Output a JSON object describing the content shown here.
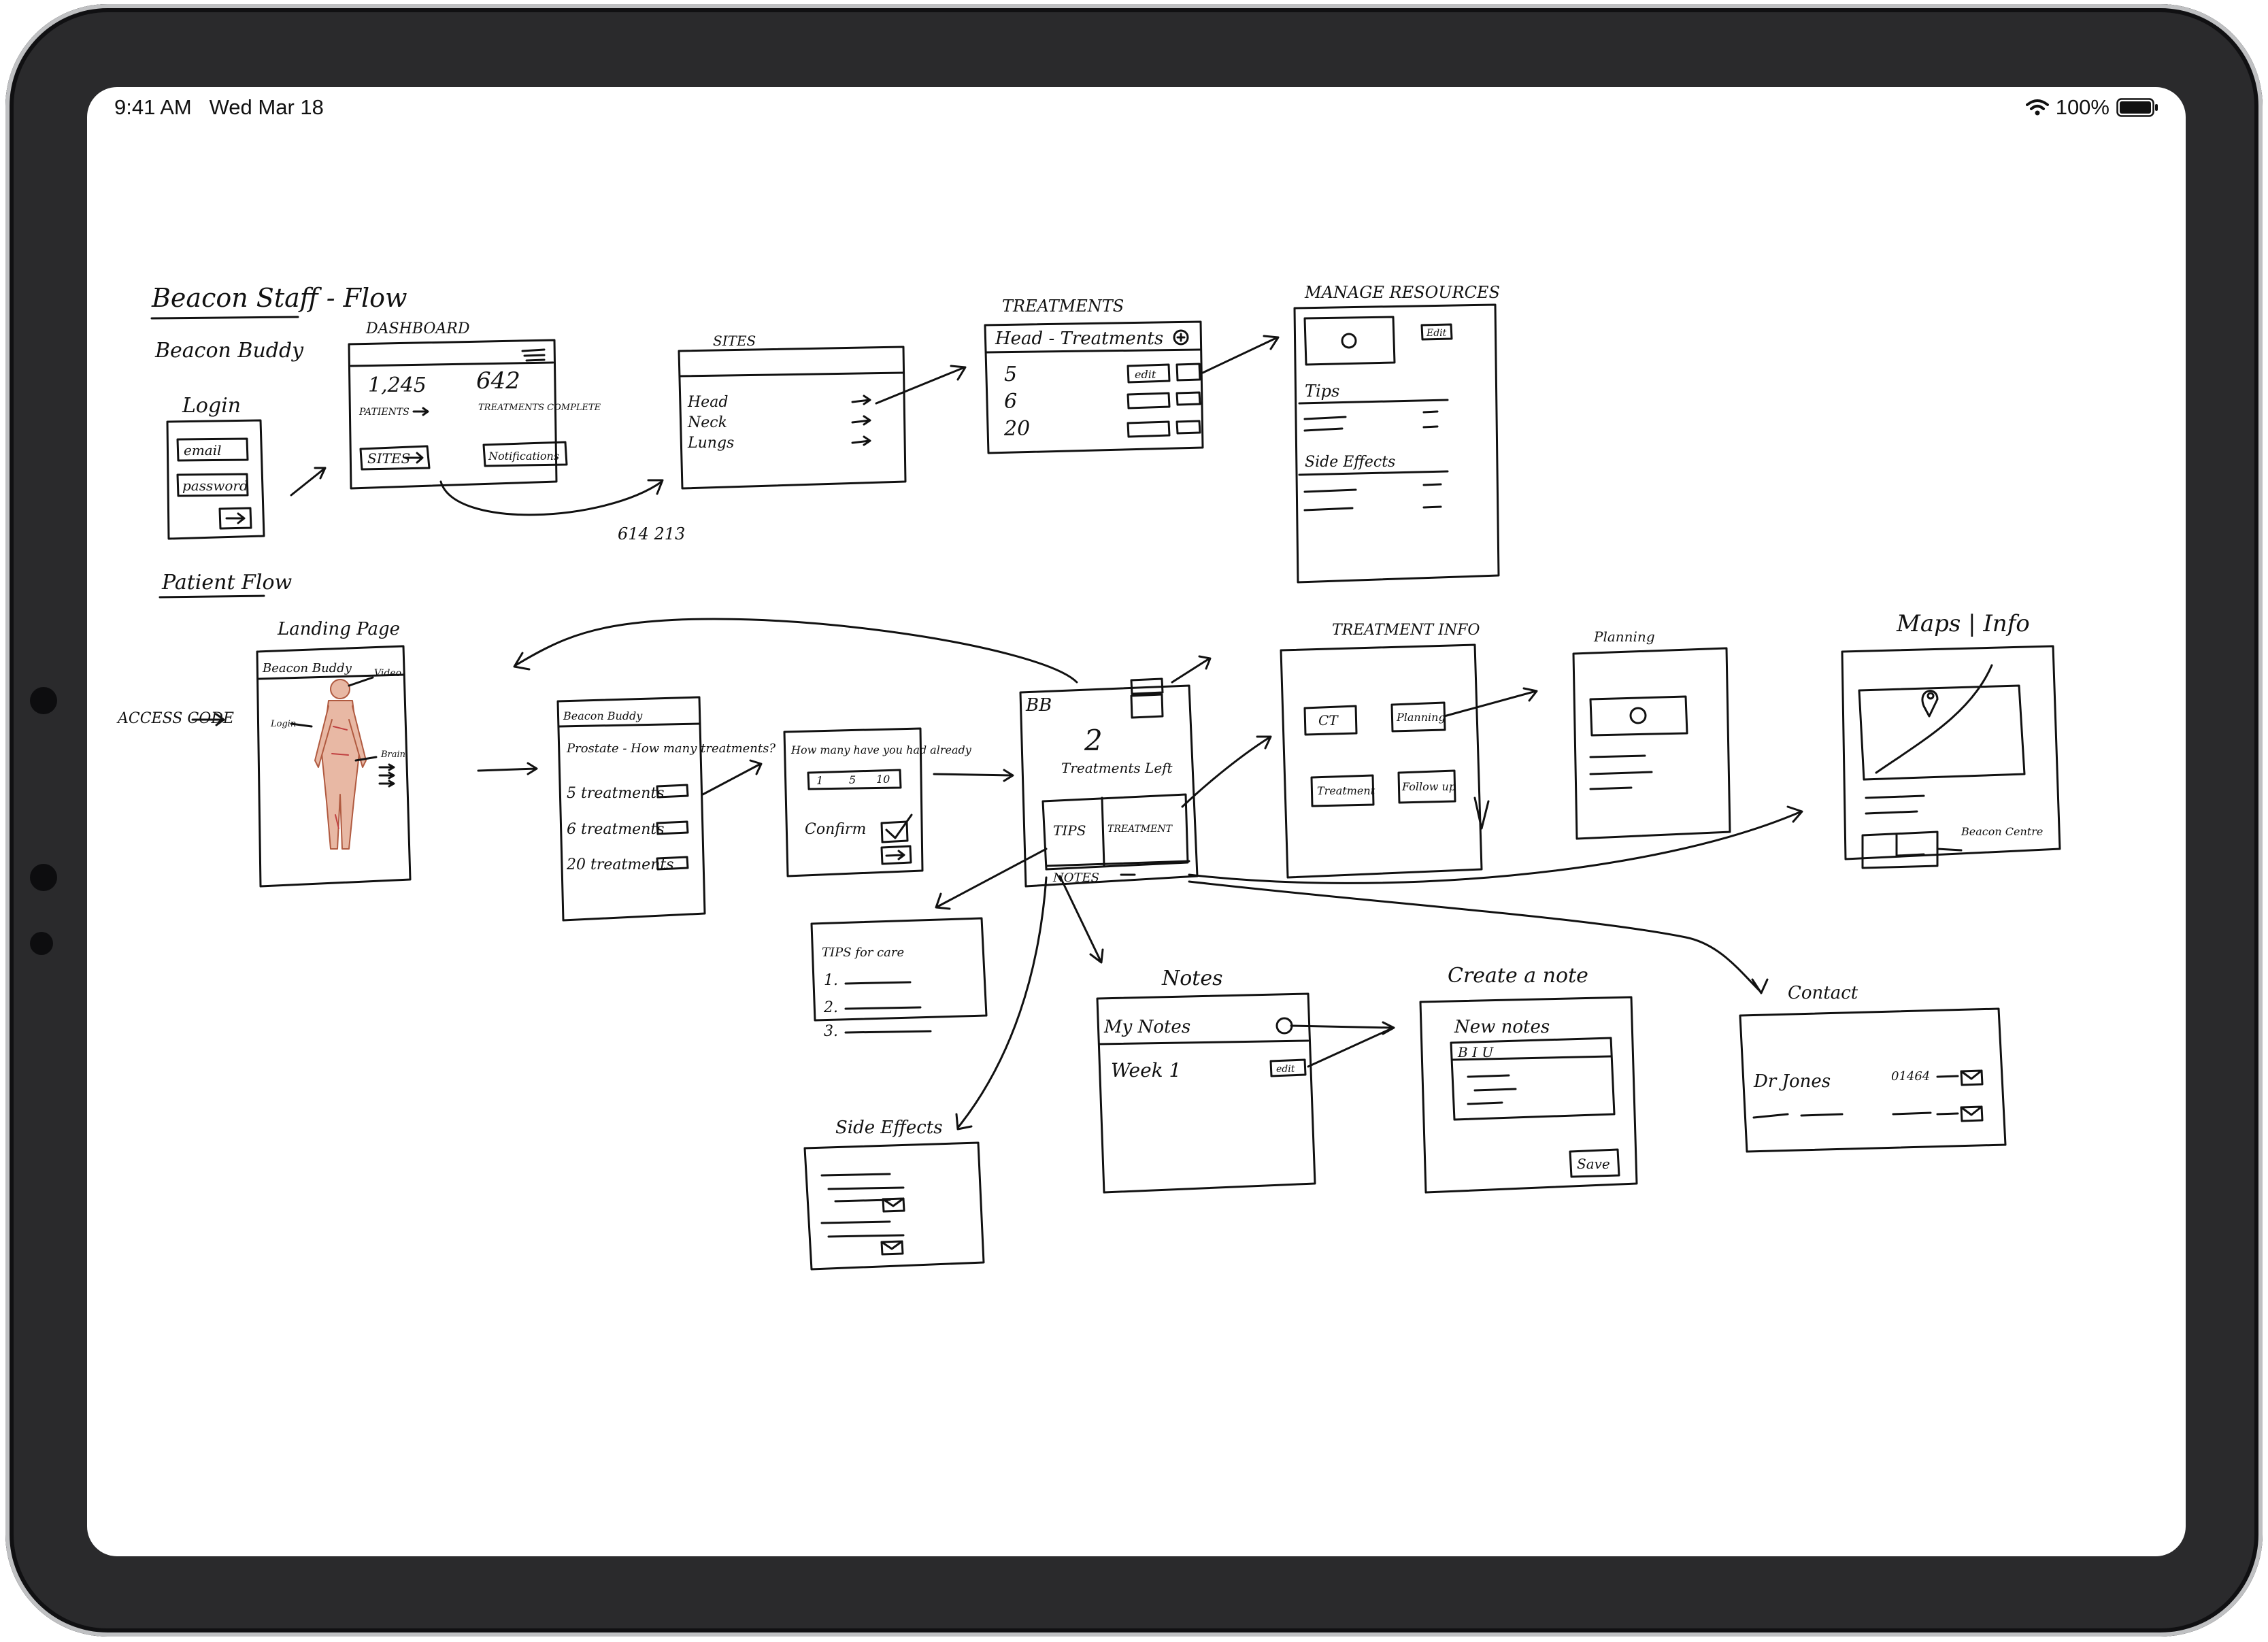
{
  "status_bar": {
    "time": "9:41 AM",
    "date": "Wed Mar 18",
    "battery": "100%",
    "icons": [
      "wifi-icon",
      "battery-icon"
    ]
  },
  "sketch": {
    "staff_flow": {
      "title": "Beacon Staff - Flow",
      "app_name": "Beacon Buddy",
      "login": {
        "title": "Login",
        "email": "email",
        "password": "password"
      },
      "dashboard": {
        "title": "DASHBOARD",
        "stat1": "1,245",
        "stat1_label": "PATIENTS",
        "stat2": "642",
        "stat2_label": "TREATMENTS COMPLETE",
        "btn_sites": "SITES",
        "btn_notifications": "Notifications"
      },
      "sites": {
        "title": "SITES",
        "items": [
          "Head",
          "Neck",
          "Lungs"
        ]
      },
      "treatments": {
        "title": "TREATMENTS",
        "header": "Head - Treatments",
        "rows": [
          "5",
          "6",
          "20"
        ],
        "edit": "edit"
      },
      "manage_resources": {
        "title": "MANAGE RESOURCES",
        "edit": "Edit",
        "tips": "Tips",
        "side_effects": "Side Effects"
      },
      "note": "614 213"
    },
    "patient_flow": {
      "title": "Patient Flow",
      "access_code": "ACCESS CODE",
      "landing": {
        "title": "Landing Page",
        "app_name": "Beacon Buddy",
        "label_video": "Video",
        "label_login": "Login",
        "label_brain": "Brain"
      },
      "select": {
        "app_name": "Beacon Buddy",
        "question": "Prostate - How many treatments?",
        "options": [
          "5 treatments",
          "6 treatments",
          "20 treatments"
        ]
      },
      "how_many": {
        "question": "How many have you had already",
        "values": [
          "1",
          "5",
          "10"
        ],
        "confirm": "Confirm"
      },
      "home": {
        "logo": "BB",
        "count": "2",
        "subtitle": "Treatments Left",
        "tips": "TIPS",
        "treatment": "TREATMENT",
        "notes": "NOTES"
      },
      "treatment_info": {
        "title": "TREATMENT INFO",
        "items": [
          "CT",
          "Planning",
          "Treatment",
          "Follow up"
        ]
      },
      "planning": {
        "title": "Planning"
      },
      "maps": {
        "title": "Maps | Info",
        "label": "Beacon Centre"
      },
      "tips_for_care": {
        "title": "TIPS for care",
        "items": [
          "1.",
          "2.",
          "3."
        ]
      },
      "side_effects": {
        "title": "Side Effects"
      },
      "notes": {
        "title": "Notes",
        "header": "My Notes",
        "item": "Week 1",
        "edit": "edit"
      },
      "create_note": {
        "title": "Create a note",
        "header": "New notes",
        "toolbar": "B I U",
        "save": "Save"
      },
      "contact": {
        "title": "Contact",
        "name": "Dr Jones",
        "phone": "01464"
      }
    }
  }
}
